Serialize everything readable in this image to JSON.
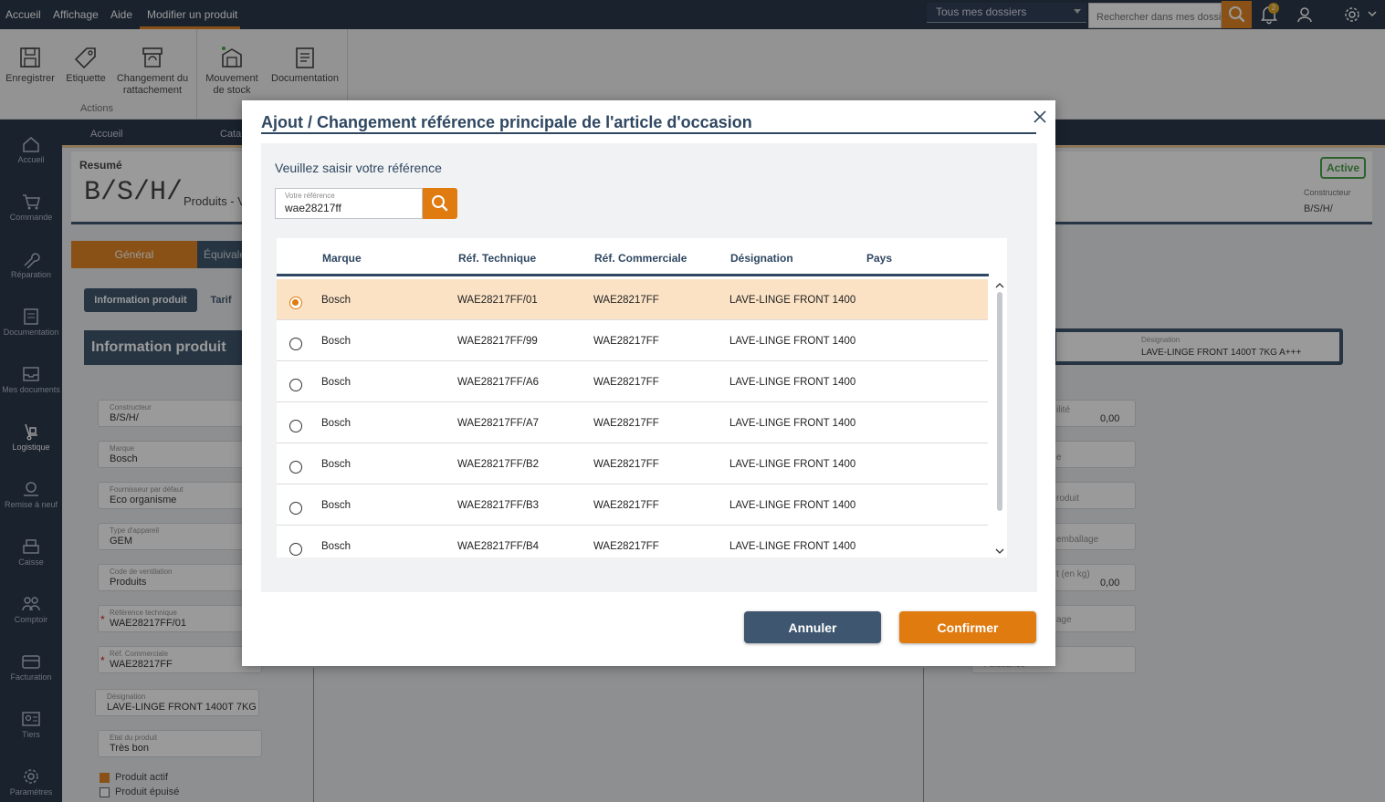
{
  "topbar": {
    "menu": [
      "Accueil",
      "Affichage",
      "Aide",
      "Modifier un produit"
    ],
    "dossiers": "Tous mes dossiers",
    "search_placeholder": "Rechercher dans mes dossiers",
    "notif_count": "2"
  },
  "ribbon": {
    "buttons": [
      {
        "label": "Enregistrer",
        "icon": "save-icon"
      },
      {
        "label": "Etiquette",
        "icon": "tag-icon"
      },
      {
        "label": "Changement du rattachement",
        "icon": "archive-refresh-icon"
      },
      {
        "label": "Mouvement de stock",
        "icon": "stock-move-icon"
      },
      {
        "label": "Documentation",
        "icon": "document-icon"
      }
    ],
    "group_label": "Actions"
  },
  "sidebar": {
    "items": [
      {
        "label": "Accueil",
        "icon": "home-icon"
      },
      {
        "label": "Commande",
        "icon": "cart-icon"
      },
      {
        "label": "Réparation",
        "icon": "wrench-icon"
      },
      {
        "label": "Documentation",
        "icon": "document-icon"
      },
      {
        "label": "Mes documents",
        "icon": "inbox-icon"
      },
      {
        "label": "Logistique",
        "icon": "logistics-icon"
      },
      {
        "label": "Remise à neuf",
        "icon": "refurbish-icon"
      },
      {
        "label": "Caisse",
        "icon": "register-icon"
      },
      {
        "label": "Comptoir",
        "icon": "counter-icon"
      },
      {
        "label": "Facturation",
        "icon": "card-icon"
      },
      {
        "label": "Tiers",
        "icon": "contact-icon"
      },
      {
        "label": "Paramètres",
        "icon": "gear-icon"
      }
    ],
    "active": "Logistique"
  },
  "background": {
    "breadcrumb": [
      "Accueil",
      "Catal"
    ],
    "resume_label": "Resumé",
    "logo_text": "B/S/H/",
    "product_path": "Produits - V",
    "status_badge": "Active",
    "constructeur_label": "Constructeur",
    "constructeur_value": "B/S/H/",
    "tabs": [
      "Général",
      "Équivale"
    ],
    "subtabs": [
      "Information produit",
      "Tarif"
    ],
    "section_title": "Information produit",
    "fields": [
      {
        "label": "Constructeur",
        "value": "B/S/H/"
      },
      {
        "label": "Marque",
        "value": "Bosch"
      },
      {
        "label": "Fournisseur par défaut",
        "value": "Eco organisme"
      },
      {
        "label": "Type d'appareil",
        "value": "GEM"
      },
      {
        "label": "Code de ventilation",
        "value": "Produits"
      },
      {
        "label": "Référence technique",
        "value": "WAE28217FF/01"
      },
      {
        "label": "Réf. Commerciale",
        "value": "WAE28217FF"
      },
      {
        "label": "Désignation",
        "value": "LAVE-LINGE FRONT 1400T 7KG A++"
      },
      {
        "label": "Etat du produit",
        "value": "Très bon"
      }
    ],
    "checkboxes": [
      {
        "label": "Produit actif",
        "checked": true
      },
      {
        "label": "Produit épuisé",
        "checked": false
      }
    ],
    "right_designation_label": "Désignation",
    "right_designation_value": "LAVE-LINGE FRONT 1400T 7KG A+++",
    "right_fields": [
      {
        "label": "ilité",
        "value": "0,00"
      },
      {
        "label": "e",
        "value": ""
      },
      {
        "label": "roduit",
        "value": ""
      },
      {
        "label": "emballage",
        "value": ""
      },
      {
        "label": "t (en kg)",
        "value": "0,00"
      },
      {
        "label": "age",
        "value": ""
      },
      {
        "label": "Puissance",
        "value": ""
      }
    ]
  },
  "dialog": {
    "title": "Ajout / Changement référence principale de l'article d'occasion",
    "prompt": "Veuillez saisir votre référence",
    "ref_label": "Votre référence",
    "ref_value": "wae28217ff",
    "columns": [
      "Marque",
      "Réf. Technique",
      "Réf. Commerciale",
      "Désignation",
      "Pays"
    ],
    "rows": [
      {
        "marque": "Bosch",
        "tech": "WAE28217FF/01",
        "comm": "WAE28217FF",
        "designation": "LAVE-LINGE FRONT 1400",
        "pays": "",
        "selected": true
      },
      {
        "marque": "Bosch",
        "tech": "WAE28217FF/99",
        "comm": "WAE28217FF",
        "designation": "LAVE-LINGE FRONT 1400",
        "pays": "",
        "selected": false
      },
      {
        "marque": "Bosch",
        "tech": "WAE28217FF/A6",
        "comm": "WAE28217FF",
        "designation": "LAVE-LINGE FRONT 1400",
        "pays": "",
        "selected": false
      },
      {
        "marque": "Bosch",
        "tech": "WAE28217FF/A7",
        "comm": "WAE28217FF",
        "designation": "LAVE-LINGE FRONT 1400",
        "pays": "",
        "selected": false
      },
      {
        "marque": "Bosch",
        "tech": "WAE28217FF/B2",
        "comm": "WAE28217FF",
        "designation": "LAVE-LINGE FRONT 1400",
        "pays": "",
        "selected": false
      },
      {
        "marque": "Bosch",
        "tech": "WAE28217FF/B3",
        "comm": "WAE28217FF",
        "designation": "LAVE-LINGE FRONT 1400",
        "pays": "",
        "selected": false
      },
      {
        "marque": "Bosch",
        "tech": "WAE28217FF/B4",
        "comm": "WAE28217FF",
        "designation": "LAVE-LINGE FRONT 1400",
        "pays": "",
        "selected": false
      }
    ],
    "cancel_label": "Annuler",
    "confirm_label": "Confirmer"
  },
  "colors": {
    "accent": "#e07b10",
    "navy": "#15253a",
    "title": "#2f4761",
    "selected_row": "#fbe2c5"
  }
}
